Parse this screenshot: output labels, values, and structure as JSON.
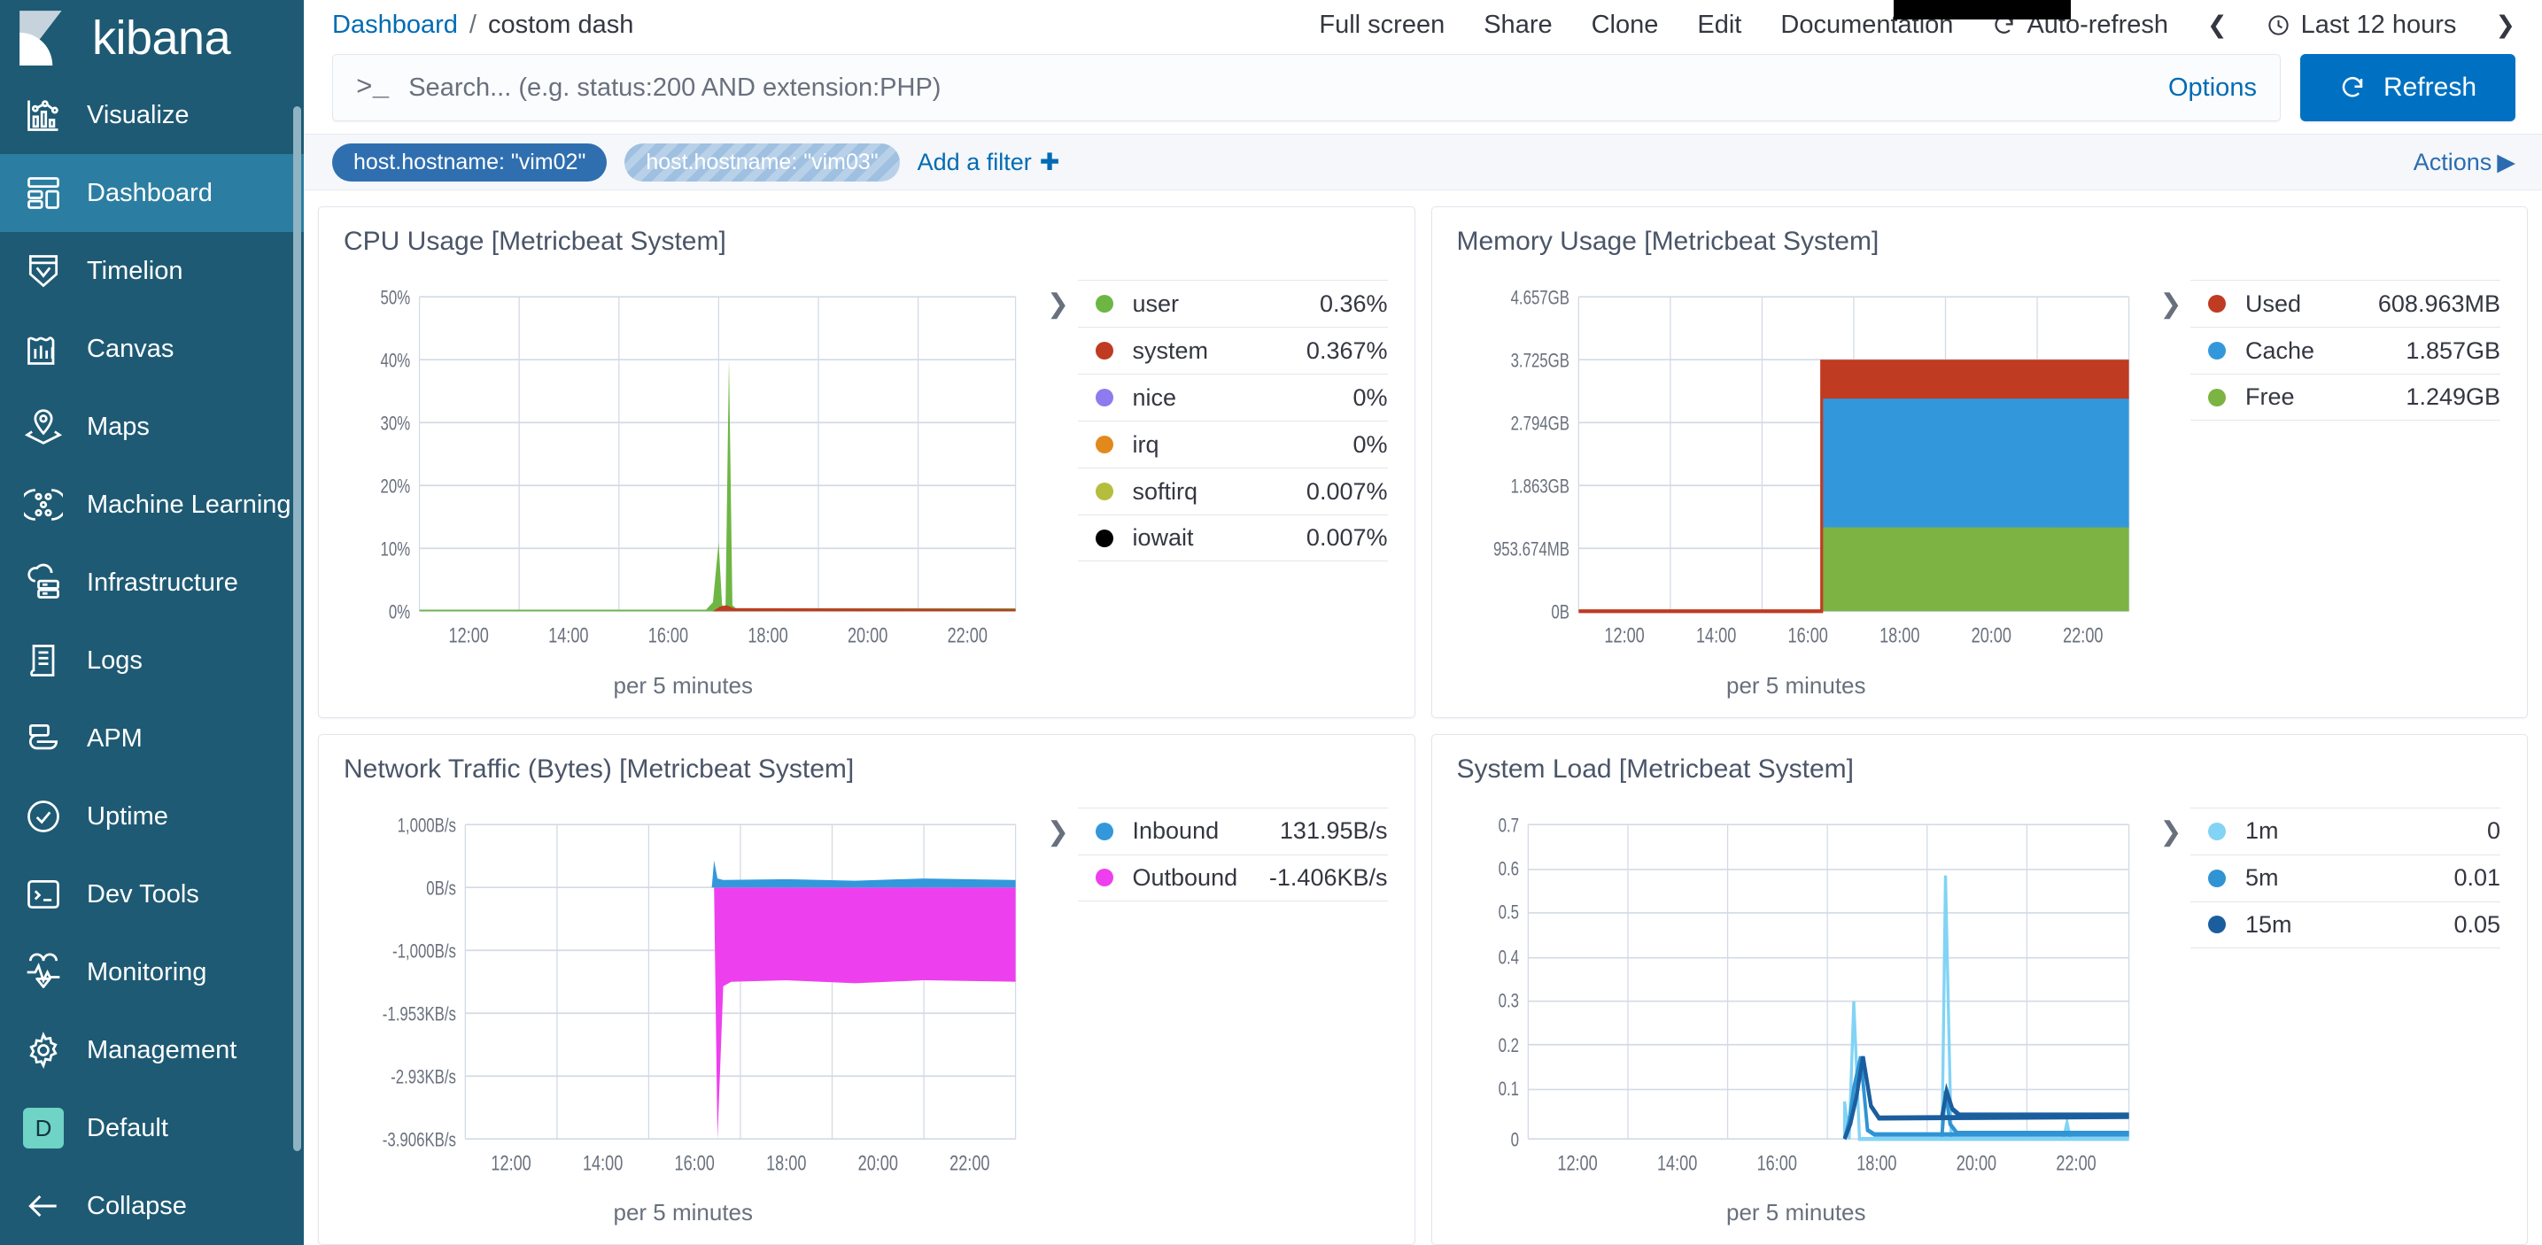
{
  "sidebar": {
    "logo_label": "kibana",
    "items": [
      {
        "label": "Visualize",
        "icon": "visualize-icon",
        "active": false
      },
      {
        "label": "Dashboard",
        "icon": "dashboard-icon",
        "active": true
      },
      {
        "label": "Timelion",
        "icon": "timelion-icon",
        "active": false
      },
      {
        "label": "Canvas",
        "icon": "canvas-icon",
        "active": false
      },
      {
        "label": "Maps",
        "icon": "maps-icon",
        "active": false
      },
      {
        "label": "Machine Learning",
        "icon": "machine-learning-icon",
        "active": false
      },
      {
        "label": "Infrastructure",
        "icon": "infrastructure-icon",
        "active": false
      },
      {
        "label": "Logs",
        "icon": "logs-icon",
        "active": false
      },
      {
        "label": "APM",
        "icon": "apm-icon",
        "active": false
      },
      {
        "label": "Uptime",
        "icon": "uptime-icon",
        "active": false
      },
      {
        "label": "Dev Tools",
        "icon": "dev-tools-icon",
        "active": false
      },
      {
        "label": "Monitoring",
        "icon": "monitoring-icon",
        "active": false
      },
      {
        "label": "Management",
        "icon": "gear-icon",
        "active": false
      }
    ],
    "space": {
      "label": "Default",
      "badge": "D",
      "badge_color": "#6fd3c5"
    },
    "collapse": {
      "label": "Collapse",
      "icon": "arrow-left-icon"
    }
  },
  "header": {
    "breadcrumb_root": "Dashboard",
    "breadcrumb_sep": "/",
    "breadcrumb_current": "costom dash",
    "nav": [
      {
        "label": "Full screen"
      },
      {
        "label": "Share"
      },
      {
        "label": "Clone"
      },
      {
        "label": "Edit"
      },
      {
        "label": "Documentation"
      },
      {
        "label": "Auto-refresh",
        "icon": "refresh-icon"
      }
    ],
    "time_prev_icon": "chevron-left-icon",
    "time_clock_icon": "clock-icon",
    "time_range": "Last 12 hours",
    "time_next_icon": "chevron-right-icon"
  },
  "query": {
    "prompt_glyph": ">_",
    "placeholder": "Search... (e.g. status:200 AND extension:PHP)",
    "value": "",
    "options_label": "Options",
    "refresh_label": "Refresh",
    "refresh_icon": "refresh-icon"
  },
  "filters": {
    "pills": [
      {
        "label": "host.hostname: \"vim02\"",
        "state": "enabled"
      },
      {
        "label": "host.hostname: \"vim03\"",
        "state": "disabled"
      }
    ],
    "add_filter_label": "Add a filter",
    "add_filter_icon": "plus-icon",
    "actions_label": "Actions",
    "actions_icon": "caret-right-icon"
  },
  "colors": {
    "brand_dark": "#1e5a74",
    "accent_blue": "#0071c2",
    "link_blue": "#006bb4",
    "green": "#6eb644",
    "red": "#bf3b21",
    "blue": "#3398db",
    "magenta": "#ee3fee",
    "light_blue": "#82d3f5",
    "mid_blue": "#2f93d4",
    "dark_blue": "#1b5e9e"
  },
  "chart_data": [
    {
      "type": "area",
      "panel_title": "CPU Usage [Metricbeat System]",
      "title": "CPU Usage [Metricbeat System]",
      "xlabel": "per 5 minutes",
      "ylabel": "",
      "grid": true,
      "legend_position": "right",
      "x_ticks": [
        "12:00",
        "14:00",
        "16:00",
        "18:00",
        "20:00",
        "22:00"
      ],
      "y_ticks": [
        "0%",
        "10%",
        "20%",
        "30%",
        "40%",
        "50%"
      ],
      "ylim": [
        0,
        50
      ],
      "legend": [
        {
          "name": "user",
          "value": "0.36%",
          "color": "#6eb644"
        },
        {
          "name": "system",
          "value": "0.367%",
          "color": "#bf3b21"
        },
        {
          "name": "nice",
          "value": "0%",
          "color": "#8e7bf0"
        },
        {
          "name": "irq",
          "value": "0%",
          "color": "#e2891c"
        },
        {
          "name": "softirq",
          "value": "0.007%",
          "color": "#b5bd3d"
        },
        {
          "name": "iowait",
          "value": "0.007%",
          "color": "#000000"
        }
      ],
      "series": [
        {
          "name": "user",
          "peak": 39.5,
          "peak_time": "17:00",
          "baseline": 0.4
        },
        {
          "name": "system",
          "peak": 1.2,
          "peak_time": "17:00",
          "baseline": 0.37
        }
      ]
    },
    {
      "type": "area",
      "panel_title": "Memory Usage [Metricbeat System]",
      "title": "Memory Usage [Metricbeat System]",
      "xlabel": "per 5 minutes",
      "ylabel": "",
      "grid": true,
      "legend_position": "right",
      "x_ticks": [
        "12:00",
        "14:00",
        "16:00",
        "18:00",
        "20:00",
        "22:00"
      ],
      "y_ticks": [
        "0B",
        "953.674MB",
        "1.863GB",
        "2.794GB",
        "3.725GB",
        "4.657GB"
      ],
      "ylim": [
        0,
        4.657
      ],
      "data_start_time": "16:40",
      "stack_total_gb": 3.725,
      "legend": [
        {
          "name": "Used",
          "value": "608.963MB",
          "color": "#bf3b21"
        },
        {
          "name": "Cache",
          "value": "1.857GB",
          "color": "#3398db"
        },
        {
          "name": "Free",
          "value": "1.249GB",
          "color": "#7cb342"
        }
      ],
      "series": [
        {
          "name": "Free",
          "value_gb": 1.249,
          "color": "#7cb342"
        },
        {
          "name": "Cache",
          "value_gb": 1.857,
          "color": "#3398db"
        },
        {
          "name": "Used",
          "value_gb": 0.609,
          "color": "#bf3b21"
        }
      ]
    },
    {
      "type": "area",
      "panel_title": "Network Traffic (Bytes) [Metricbeat System]",
      "title": "Network Traffic (Bytes) [Metricbeat System]",
      "xlabel": "per 5 minutes",
      "ylabel": "",
      "grid": true,
      "legend_position": "right",
      "x_ticks": [
        "12:00",
        "14:00",
        "16:00",
        "18:00",
        "20:00",
        "22:00"
      ],
      "y_ticks": [
        "-3.906KB/s",
        "-2.93KB/s",
        "-1.953KB/s",
        "-1,000B/s",
        "0B/s",
        "1,000B/s"
      ],
      "ylim": [
        -3.906,
        1.0
      ],
      "data_start_time": "16:45",
      "legend": [
        {
          "name": "Inbound",
          "value": "131.95B/s",
          "color": "#3398db"
        },
        {
          "name": "Outbound",
          "value": "-1.406KB/s",
          "color": "#ee3fee"
        }
      ],
      "series": [
        {
          "name": "Inbound",
          "typical": 0.132,
          "peak": 0.62,
          "color": "#3398db"
        },
        {
          "name": "Outbound",
          "typical": -1.406,
          "peak": -3.85,
          "color": "#ee3fee"
        }
      ]
    },
    {
      "type": "line",
      "panel_title": "System Load [Metricbeat System]",
      "title": "System Load [Metricbeat System]",
      "xlabel": "per 5 minutes",
      "ylabel": "",
      "grid": true,
      "legend_position": "right",
      "x_ticks": [
        "12:00",
        "14:00",
        "16:00",
        "18:00",
        "20:00",
        "22:00"
      ],
      "y_ticks": [
        "0",
        "0.1",
        "0.2",
        "0.3",
        "0.4",
        "0.5",
        "0.6",
        "0.7"
      ],
      "ylim": [
        0,
        0.7
      ],
      "data_start_time": "16:40",
      "legend": [
        {
          "name": "1m",
          "value": "0",
          "color": "#82d3f5"
        },
        {
          "name": "5m",
          "value": "0.01",
          "color": "#2f93d4"
        },
        {
          "name": "15m",
          "value": "0.05",
          "color": "#1b5e9e"
        }
      ],
      "series": [
        {
          "name": "1m",
          "peaks": [
            {
              "time": "17:00",
              "value": 0.33
            },
            {
              "time": "19:05",
              "value": 0.59
            },
            {
              "time": "22:00",
              "value": 0.04
            }
          ],
          "baseline": 0.0
        },
        {
          "name": "5m",
          "peaks": [
            {
              "time": "17:05",
              "value": 0.19
            }
          ],
          "baseline": 0.01
        },
        {
          "name": "15m",
          "peaks": [
            {
              "time": "17:05",
              "value": 0.19
            }
          ],
          "baseline": 0.05
        }
      ]
    }
  ]
}
